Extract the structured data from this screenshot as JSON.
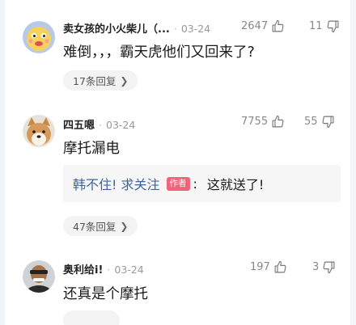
{
  "comments": [
    {
      "username": "卖女孩的小火柴儿（...",
      "time": "03-24",
      "likes": "2647",
      "dislikes": "11",
      "text": "难倒，，，霸天虎他们又回来了?",
      "replies": "17条回复"
    },
    {
      "username": "四五嗯",
      "time": "03-24",
      "likes": "7755",
      "dislikes": "55",
      "text": "摩托漏电",
      "quote": {
        "author": "韩不住! 求关注",
        "badge": "作者",
        "colon": ":",
        "text": "这就送了!"
      },
      "replies": "47条回复"
    },
    {
      "username": "奥利给i!",
      "time": "03-24",
      "likes": "197",
      "dislikes": "3",
      "text": "还真是个摩托"
    }
  ],
  "icons": {
    "like": "thumbs-up-outline-icon",
    "dislike": "thumbs-down-outline-icon",
    "replies_chevron": "chevron-right-icon"
  },
  "colors": {
    "link": "#406599",
    "author_badge": "#f0637a",
    "secondary_text": "#999999"
  }
}
